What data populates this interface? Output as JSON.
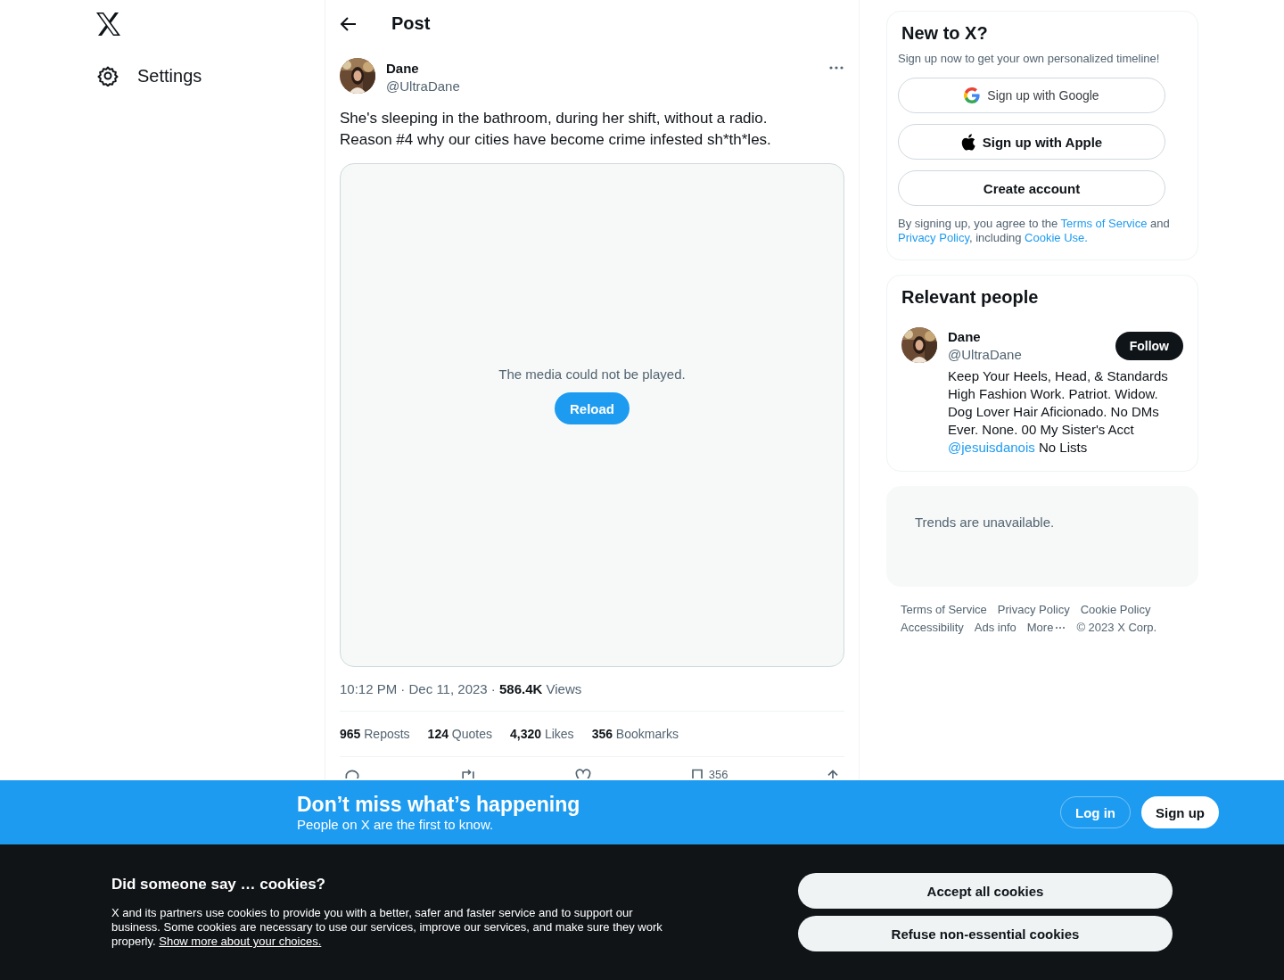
{
  "nav": {
    "items": [
      {
        "kind": "settings",
        "label": "Settings"
      }
    ]
  },
  "post": {
    "header_title": "Post",
    "author": {
      "name": "Dane",
      "handle": "@UltraDane"
    },
    "text": "She's sleeping in the bathroom, during her shift, without a radio.\nReason #4 why our cities have become crime infested sh*th*les.",
    "media": {
      "message": "The media could not be played.",
      "button": "Reload"
    },
    "meta": "10:12 PM · Dec 11, 2023 · **586.4K** Views",
    "stats": [
      {
        "text": "**965** Reposts"
      },
      {
        "text": "**124** Quotes"
      },
      {
        "text": "**4,320** Likes"
      },
      {
        "text": "**356** Bookmarks"
      }
    ],
    "actions": [
      {
        "kind": "reply"
      },
      {
        "kind": "repost"
      },
      {
        "kind": "like"
      },
      {
        "kind": "bookmark",
        "count": "356"
      },
      {
        "kind": "share"
      }
    ]
  },
  "sidebar": {
    "signup": {
      "title": "New to X?",
      "subtitle": "Sign up now to get your own personalized timeline!",
      "buttons": [
        {
          "kind": "google",
          "label": "Sign up with Google"
        },
        {
          "kind": "apple",
          "label": "Sign up with Apple"
        },
        {
          "kind": "plain",
          "label": "Create account"
        }
      ],
      "legal": [
        {
          "text": "By signing up, you agree to the ",
          "kind": "text"
        },
        {
          "text": "Terms of Service",
          "kind": "link"
        },
        {
          "text": " and ",
          "kind": "text"
        },
        {
          "text": "Privacy Policy",
          "kind": "link"
        },
        {
          "text": ", including ",
          "kind": "text"
        },
        {
          "text": "Cookie Use.",
          "kind": "link"
        }
      ]
    },
    "relevant": {
      "title": "Relevant people",
      "person": {
        "name": "Dane",
        "handle": "@UltraDane",
        "button": "Follow",
        "bio": [
          {
            "text": "Keep Your Heels, Head, & Standards High Fashion Work. Patriot. Widow. Dog Lover Hair Aficionado. No DMs Ever. None. 00 My Sister's Acct ",
            "kind": "text"
          },
          {
            "text": "@jesuisdanois",
            "kind": "link"
          },
          {
            "text": " No Lists",
            "kind": "text"
          }
        ]
      }
    },
    "trends": {
      "message": "Trends are unavailable."
    },
    "footer": {
      "links": [
        "Terms of Service",
        "Privacy Policy",
        "Cookie Policy",
        "Accessibility",
        "Ads info",
        "More"
      ],
      "copyright": "© 2023 X Corp."
    }
  },
  "banner": {
    "title": "Don’t miss what’s happening",
    "subtitle": "People on X are the first to know.",
    "buttons": [
      {
        "kind": "outline",
        "label": "Log in"
      },
      {
        "kind": "filled",
        "label": "Sign up"
      }
    ]
  },
  "cookies": {
    "title": "Did someone say … cookies?",
    "body": "X and its partners use cookies to provide you with a better, safer and faster service and to support our business. Some cookies are necessary to use our services, improve our services, and make sure they work properly.",
    "link": "Show more about your choices.",
    "buttons": [
      "Accept all cookies",
      "Refuse non-essential cookies"
    ]
  }
}
